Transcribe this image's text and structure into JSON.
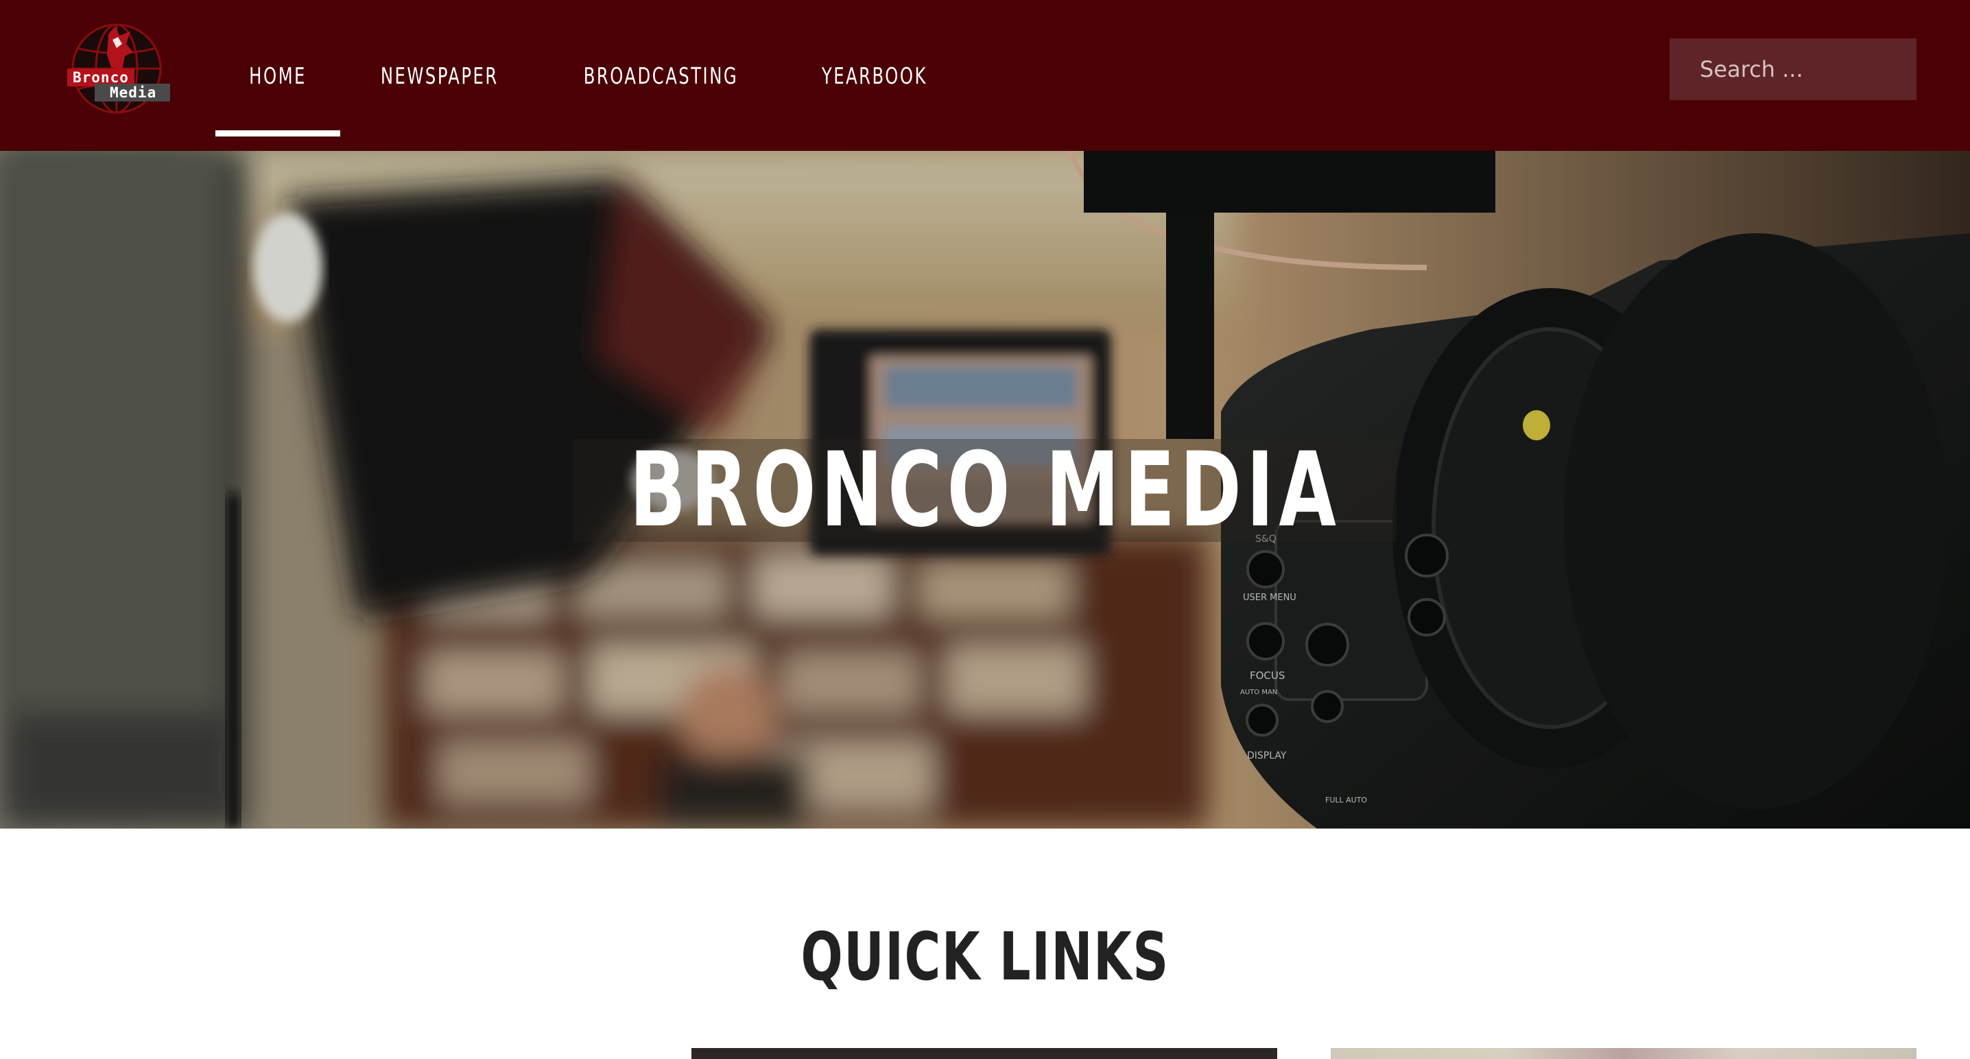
{
  "header": {
    "logo": {
      "line1": "Bronco",
      "line2": "Media"
    },
    "nav": [
      {
        "label": "HOME",
        "active": true
      },
      {
        "label": "NEWSPAPER",
        "active": false
      },
      {
        "label": "BROADCASTING",
        "active": false
      },
      {
        "label": "YEARBOOK",
        "active": false
      }
    ],
    "search": {
      "placeholder": "Search ...",
      "icon": "search-icon"
    }
  },
  "hero": {
    "title": "BRONCO MEDIA",
    "camera_labels": [
      "S&Q",
      "USER MENU",
      "FOCUS",
      "DISPLAY",
      "AUTO MAN",
      "FULL AUTO"
    ]
  },
  "quick_links": {
    "heading": "QUICK LINKS"
  },
  "colors": {
    "header_bg": "#4a0004",
    "search_bg": "#5f2427",
    "active_underline": "#ffffff",
    "heading_text": "#222222"
  }
}
